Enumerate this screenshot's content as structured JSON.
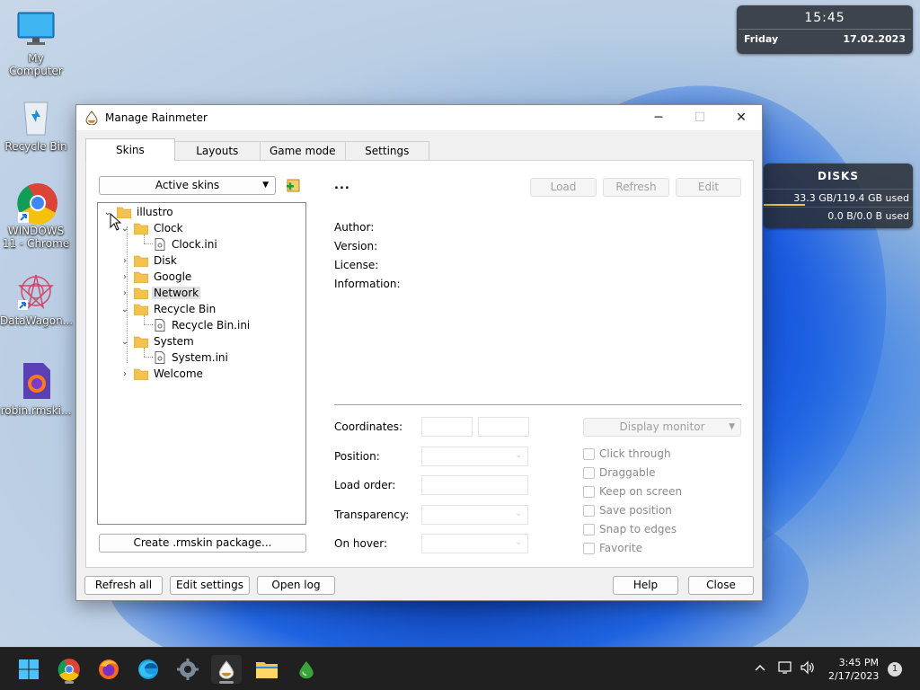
{
  "desktop": {
    "icons": [
      {
        "label": "My Computer"
      },
      {
        "label": "Recycle Bin"
      },
      {
        "label": "WINDOWS 11 - Chrome"
      },
      {
        "label": "DataWagon..."
      },
      {
        "label": "robin.rmski..."
      }
    ]
  },
  "clock_widget": {
    "time": "15:45",
    "day": "Friday",
    "date": "17.02.2023"
  },
  "disk_widget": {
    "title": "DISKS",
    "disks": [
      {
        "usage": "33.3 GB/119.4 GB used",
        "fill_fraction": 0.28
      },
      {
        "usage": "0.0 B/0.0 B used",
        "fill_fraction": 0
      }
    ],
    "bar_color": "#e8c547"
  },
  "window": {
    "title": "Manage Rainmeter",
    "controls": {
      "minimize": "─",
      "maximize": "☐",
      "close": "✕"
    },
    "tabs": [
      {
        "label": "Skins",
        "active": true
      },
      {
        "label": "Layouts",
        "active": false
      },
      {
        "label": "Game mode",
        "active": false
      },
      {
        "label": "Settings",
        "active": false
      }
    ],
    "active_skins_label": "Active skins",
    "dropdown_arrow": "▼",
    "tree": [
      {
        "label": "illustro",
        "type": "folder",
        "expanded": true
      },
      {
        "label": "Clock",
        "type": "folder",
        "expanded": true
      },
      {
        "label": "Clock.ini",
        "type": "file"
      },
      {
        "label": "Disk",
        "type": "folder",
        "expanded": false
      },
      {
        "label": "Google",
        "type": "folder",
        "expanded": false
      },
      {
        "label": "Network",
        "type": "folder",
        "expanded": false,
        "selected": true
      },
      {
        "label": "Recycle Bin",
        "type": "folder",
        "expanded": true
      },
      {
        "label": "Recycle Bin.ini",
        "type": "file"
      },
      {
        "label": "System",
        "type": "folder",
        "expanded": true
      },
      {
        "label": "System.ini",
        "type": "file"
      },
      {
        "label": "Welcome",
        "type": "folder",
        "expanded": false
      }
    ],
    "create_package_label": "Create .rmskin package...",
    "skin_name": "...",
    "actions": {
      "load": "Load",
      "refresh": "Refresh",
      "edit": "Edit"
    },
    "info": {
      "author": "Author:",
      "version": "Version:",
      "license": "License:",
      "information": "Information:"
    },
    "fields": {
      "coordinates": "Coordinates:",
      "position": "Position:",
      "load_order": "Load order:",
      "transparency": "Transparency:",
      "on_hover": "On hover:"
    },
    "display_monitor_label": "Display monitor",
    "options": [
      {
        "label": "Click through",
        "checked": false
      },
      {
        "label": "Draggable",
        "checked": false
      },
      {
        "label": "Keep on screen",
        "checked": false
      },
      {
        "label": "Save position",
        "checked": false
      },
      {
        "label": "Snap to edges",
        "checked": false
      },
      {
        "label": "Favorite",
        "checked": false
      }
    ],
    "bottom": {
      "refresh_all": "Refresh all",
      "edit_settings": "Edit settings",
      "open_log": "Open log",
      "help": "Help",
      "close": "Close"
    }
  },
  "taskbar": {
    "apps": [
      "start-icon",
      "chrome-icon",
      "firefox-icon",
      "edge-icon",
      "settings-icon",
      "rainmeter-icon",
      "file-explorer-icon",
      "droplet-app-icon"
    ],
    "tray_time": "3:45 PM",
    "tray_date": "2/17/2023",
    "notification_count": "1"
  },
  "colors": {
    "accent": "#0067c0",
    "folder": "#f2c14e",
    "taskbar": "#202020"
  }
}
